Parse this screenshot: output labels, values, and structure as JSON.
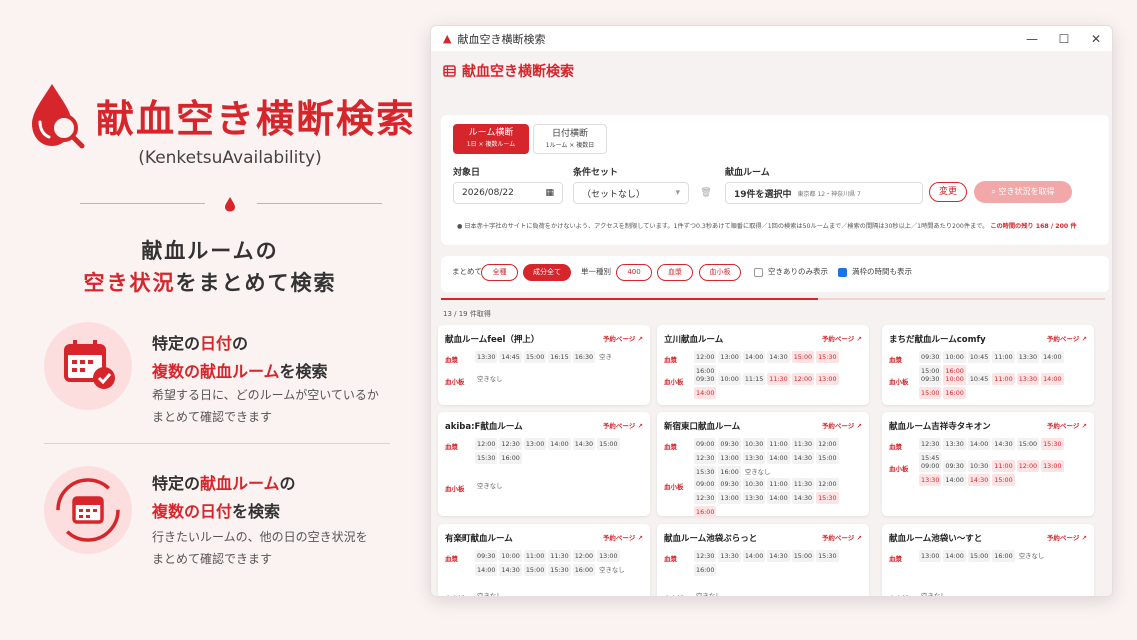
{
  "promo": {
    "title": "献血空き横断検索",
    "subtitle": "(KenketsuAvailability)",
    "tagline1": "献血ルームの",
    "tagline2_red": "空き状況",
    "tagline2_rest": "をまとめて検索",
    "feature1": {
      "h1a": "特定の",
      "h1b": "日付",
      "h1c": "の",
      "h2a": "複数の献血ルーム",
      "h2b": "を検索",
      "d1": "希望する日に、どのルームが空いているか",
      "d2": "まとめて確認できます"
    },
    "feature2": {
      "h1a": "特定の",
      "h1b": "献血ルーム",
      "h1c": "の",
      "h2a": "複数の日付",
      "h2b": "を検索",
      "d1": "行きたいルームの、他の日の空き状況を",
      "d2": "まとめて確認できます"
    }
  },
  "window": {
    "title": "献血空き横断検索",
    "header": "献血空き横断検索"
  },
  "modes": [
    {
      "label": "ルーム横断",
      "sub": "1日 × 複数ルーム"
    },
    {
      "label": "日付横断",
      "sub": "1ルーム × 複数日"
    }
  ],
  "form": {
    "date_label": "対象日",
    "date_value": "2026/08/22",
    "cond_label": "条件セット",
    "cond_value": "（セットなし）",
    "room_label": "献血ルーム",
    "room_value": "19件を選択中",
    "room_sub": "東京都 12・神奈川県 7",
    "change": "変更",
    "fetch": "空き状況を取得"
  },
  "note": {
    "text": "日本赤十字社のサイトに負荷をかけないよう、アクセスを制限しています。1件ずつ0.3秒あけて順番に取得／1回の検索は50ルームまで／検索の間隔は30秒以上／1時間あたり200件まで。",
    "remain": "この時間の残り 168 / 200 件"
  },
  "options": {
    "matome": "まとめて",
    "all": "全種",
    "seibun": "成分全て",
    "tanitsu": "単一種別",
    "p400": "400",
    "kessho": "血漿",
    "kesshoban": "血小板",
    "only_avail": "空きありのみ表示",
    "show_full": "満枠の時間も表示"
  },
  "count": "13 / 19 件取得",
  "cards": [
    {
      "name": "献血ルームfeel（押上）",
      "link": "予約ページ",
      "rows": [
        {
          "k": "血漿",
          "v": [
            "13:30",
            "14:45",
            "15:00",
            "16:15",
            "16:30",
            "空き"
          ]
        },
        {
          "k": "血小板",
          "v": [
            "空きなし"
          ]
        }
      ]
    },
    {
      "name": "立川献血ルーム",
      "link": "予約ページ",
      "rows": [
        {
          "k": "血漿",
          "v": [
            "12:00",
            "13:00",
            "14:00",
            "14:30",
            "15:00",
            "15:30",
            "16:00"
          ]
        },
        {
          "k": "血小板",
          "v": [
            "09:30",
            "10:00",
            "11:15",
            "11:30",
            "12:00",
            "13:00",
            "14:00"
          ]
        }
      ]
    },
    {
      "name": "まちだ献血ルームcomfy",
      "link": "予約ページ",
      "rows": [
        {
          "k": "血漿",
          "v": [
            "09:30",
            "10:00",
            "10:45",
            "11:00",
            "13:30",
            "14:00",
            "15:00",
            "16:00"
          ]
        },
        {
          "k": "血小板",
          "v": [
            "09:30",
            "10:00",
            "10:45",
            "11:00",
            "13:30",
            "14:00",
            "15:00",
            "16:00"
          ]
        }
      ]
    },
    {
      "name": "akiba:F献血ルーム",
      "link": "予約ページ",
      "rows": [
        {
          "k": "血漿",
          "v": [
            "12:00",
            "12:30",
            "13:00",
            "14:00",
            "14:30",
            "15:00",
            "15:30",
            "16:00"
          ]
        },
        {
          "k": "血小板",
          "v": [
            "空きなし"
          ]
        }
      ]
    },
    {
      "name": "新宿東口献血ルーム",
      "link": "予約ページ",
      "rows": [
        {
          "k": "血漿",
          "v": [
            "09:00",
            "09:30",
            "10:30",
            "11:00",
            "11:30",
            "12:00",
            "12:30",
            "13:00",
            "13:30",
            "14:00",
            "14:30",
            "15:00",
            "15:30",
            "16:00",
            "空きなし"
          ]
        },
        {
          "k": "血小板",
          "v": [
            "09:00",
            "09:30",
            "10:30",
            "11:00",
            "11:30",
            "12:00",
            "12:30",
            "13:00",
            "13:30",
            "14:00",
            "14:30",
            "15:30",
            "16:00"
          ]
        }
      ]
    },
    {
      "name": "献血ルーム吉祥寺タキオン",
      "link": "予約ページ",
      "rows": [
        {
          "k": "血漿",
          "v": [
            "12:30",
            "13:30",
            "14:00",
            "14:30",
            "15:00",
            "15:30",
            "15:45"
          ]
        },
        {
          "k": "血小板",
          "v": [
            "09:00",
            "09:30",
            "10:30",
            "11:00",
            "12:00",
            "13:00",
            "13:30",
            "14:00",
            "14:30",
            "15:00"
          ]
        }
      ]
    },
    {
      "name": "有楽町献血ルーム",
      "link": "予約ページ",
      "rows": [
        {
          "k": "血漿",
          "v": [
            "09:30",
            "10:00",
            "11:00",
            "11:30",
            "12:00",
            "13:00",
            "14:00",
            "14:30",
            "15:00",
            "15:30",
            "16:00",
            "空きなし"
          ]
        },
        {
          "k": "血小板",
          "v": [
            "空きなし"
          ]
        }
      ]
    },
    {
      "name": "献血ルーム池袋ぶらっと",
      "link": "予約ページ",
      "rows": [
        {
          "k": "血漿",
          "v": [
            "12:30",
            "13:30",
            "14:00",
            "14:30",
            "15:00",
            "15:30",
            "16:00"
          ]
        },
        {
          "k": "血小板",
          "v": [
            "空きなし"
          ]
        }
      ]
    },
    {
      "name": "献血ルーム池袋い〜すと",
      "link": "予約ページ",
      "rows": [
        {
          "k": "血漿",
          "v": [
            "13:00",
            "14:00",
            "15:00",
            "16:00",
            "空きなし"
          ]
        },
        {
          "k": "血小板",
          "v": [
            "空きなし"
          ]
        }
      ]
    }
  ],
  "colors": {
    "accent": "#d6262b",
    "accent_light": "#fde3e3",
    "bg": "#fbf3f2"
  }
}
